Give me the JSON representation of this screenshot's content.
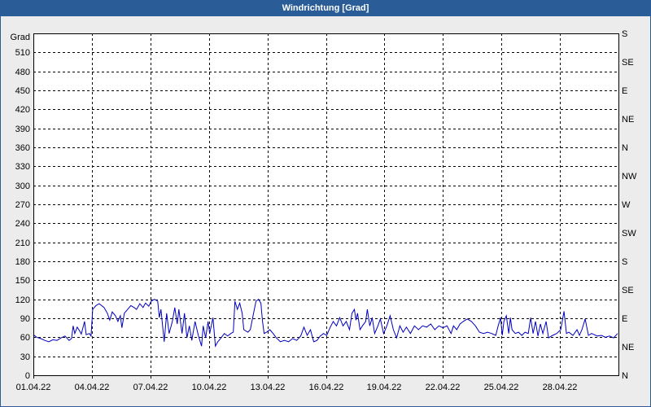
{
  "chart_data": {
    "type": "line",
    "title": "Windrichtung [Grad]",
    "xlabel": "",
    "ylabel": "Grad",
    "xlim": [
      "01.04.22 00:00",
      "01.05.22 00:00"
    ],
    "ylim": [
      0,
      540
    ],
    "grid": true,
    "x_ticks": [
      "01.04.22",
      "04.04.22",
      "07.04.22",
      "10.04.22",
      "13.04.22",
      "16.04.22",
      "19.04.22",
      "22.04.22",
      "25.04.22",
      "28.04.22"
    ],
    "y_ticks": [
      0,
      30,
      60,
      90,
      120,
      150,
      180,
      210,
      240,
      270,
      300,
      330,
      360,
      390,
      420,
      450,
      480,
      510
    ],
    "y2_ticks": [
      {
        "value": 0,
        "label": "N"
      },
      {
        "value": 45,
        "label": "NE"
      },
      {
        "value": 90,
        "label": "E"
      },
      {
        "value": 135,
        "label": "SE"
      },
      {
        "value": 180,
        "label": "S"
      },
      {
        "value": 225,
        "label": "SW"
      },
      {
        "value": 270,
        "label": "W"
      },
      {
        "value": 315,
        "label": "NW"
      },
      {
        "value": 360,
        "label": "N"
      },
      {
        "value": 405,
        "label": "NE"
      },
      {
        "value": 450,
        "label": "E"
      },
      {
        "value": 495,
        "label": "SE"
      },
      {
        "value": 540,
        "label": "S"
      }
    ],
    "colors": {
      "series": "#0000c0",
      "title_bar": "#2a5d98",
      "grid": "#000000",
      "plot_background": "#ffffff",
      "panel_background": "#ececec"
    },
    "series": [
      {
        "x": [
          "01.04.22 00:00",
          "01.04.22 04:00",
          "01.04.22 09:00",
          "01.04.22 14:00",
          "01.04.22 19:00",
          "02.04.22 00:00",
          "02.04.22 05:00",
          "02.04.22 10:00",
          "02.04.22 15:00",
          "02.04.22 20:00",
          "02.04.22 23:00",
          "03.04.22 01:00",
          "03.04.22 03:00",
          "03.04.22 06:00",
          "03.04.22 09:00",
          "03.04.22 11:00",
          "03.04.22 15:00",
          "03.04.22 17:00",
          "03.04.22 21:00",
          "03.04.22 23:00",
          "04.04.22 01:00",
          "04.04.22 05:00",
          "04.04.22 09:00",
          "04.04.22 15:00",
          "04.04.22 19:00",
          "04.04.22 22:00",
          "05.04.22 01:00",
          "05.04.22 05:00",
          "05.04.22 08:00",
          "05.04.22 11:00",
          "05.04.22 13:00",
          "05.04.22 16:00",
          "05.04.22 20:00",
          "06.04.22 00:00",
          "06.04.22 04:00",
          "06.04.22 07:00",
          "06.04.22 11:00",
          "06.04.22 15:00",
          "06.04.22 18:00",
          "06.04.22 22:00",
          "07.04.22 01:00",
          "07.04.22 05:00",
          "07.04.22 09:00",
          "07.04.22 11:00",
          "07.04.22 13:00",
          "07.04.22 15:00",
          "07.04.22 17:00",
          "07.04.22 20:00",
          "07.04.22 23:00",
          "08.04.22 03:00",
          "08.04.22 06:00",
          "08.04.22 09:00",
          "08.04.22 11:00",
          "08.04.22 15:00",
          "08.04.22 18:00",
          "08.04.22 21:00",
          "09.04.22 00:00",
          "09.04.22 03:00",
          "09.04.22 07:00",
          "09.04.22 11:00",
          "09.04.22 15:00",
          "09.04.22 17:00",
          "09.04.22 20:00",
          "09.04.22 23:00",
          "10.04.22 01:00",
          "10.04.22 05:00",
          "10.04.22 08:00",
          "10.04.22 11:00",
          "10.04.22 15:00",
          "10.04.22 19:00",
          "10.04.22 23:00",
          "11.04.22 03:00",
          "11.04.22 06:00",
          "11.04.22 08:00",
          "11.04.22 11:00",
          "11.04.22 14:00",
          "11.04.22 17:00",
          "11.04.22 19:00",
          "12.04.22 00:00",
          "12.04.22 03:00",
          "12.04.22 07:00",
          "12.04.22 10:00",
          "12.04.22 13:00",
          "12.04.22 16:00",
          "12.04.22 18:00",
          "12.04.22 20:00",
          "12.04.22 23:00",
          "13.04.22 03:00",
          "13.04.22 07:00",
          "13.04.22 11:00",
          "13.04.22 16:00",
          "13.04.22 21:00",
          "14.04.22 02:00",
          "14.04.22 07:00",
          "14.04.22 12:00",
          "14.04.22 17:00",
          "14.04.22 21:00",
          "15.04.22 01:00",
          "15.04.22 05:00",
          "15.04.22 09:00",
          "15.04.22 13:00",
          "15.04.22 17:00",
          "15.04.22 21:00",
          "16.04.22 01:00",
          "16.04.22 05:00",
          "16.04.22 09:00",
          "16.04.22 13:00",
          "16.04.22 17:00",
          "16.04.22 21:00",
          "17.04.22 01:00",
          "17.04.22 05:00",
          "17.04.22 08:00",
          "17.04.22 11:00",
          "17.04.22 13:00",
          "17.04.22 15:00",
          "17.04.22 18:00",
          "17.04.22 21:00",
          "18.04.22 01:00",
          "18.04.22 03:00",
          "18.04.22 06:00",
          "18.04.22 09:00",
          "18.04.22 12:00",
          "18.04.22 16:00",
          "18.04.22 19:00",
          "18.04.22 23:00",
          "19.04.22 03:00",
          "19.04.22 07:00",
          "19.04.22 11:00",
          "19.04.22 15:00",
          "19.04.22 19:00",
          "19.04.22 23:00",
          "20.04.22 03:00",
          "20.04.22 08:00",
          "20.04.22 13:00",
          "20.04.22 18:00",
          "20.04.22 23:00",
          "21.04.22 04:00",
          "21.04.22 09:00",
          "21.04.22 14:00",
          "21.04.22 19:00",
          "22.04.22 00:00",
          "22.04.22 05:00",
          "22.04.22 10:00",
          "22.04.22 13:00",
          "22.04.22 17:00",
          "22.04.22 21:00",
          "23.04.22 01:00",
          "23.04.22 06:00",
          "23.04.22 11:00",
          "23.04.22 16:00",
          "23.04.22 21:00",
          "24.04.22 02:00",
          "24.04.22 07:00",
          "24.04.22 12:00",
          "24.04.22 17:00",
          "24.04.22 20:00",
          "24.04.22 23:00",
          "25.04.22 01:00",
          "25.04.22 03:00",
          "25.04.22 06:00",
          "25.04.22 09:00",
          "25.04.22 11:00",
          "25.04.22 13:00",
          "25.04.22 17:00",
          "25.04.22 21:00",
          "26.04.22 01:00",
          "26.04.22 05:00",
          "26.04.22 09:00",
          "26.04.22 12:00",
          "26.04.22 15:00",
          "26.04.22 18:00",
          "26.04.22 21:00",
          "27.04.22 00:00",
          "27.04.22 03:00",
          "27.04.22 07:00",
          "27.04.22 10:00",
          "27.04.22 15:00",
          "27.04.22 20:00",
          "28.04.22 01:00",
          "28.04.22 05:00",
          "28.04.22 08:00",
          "28.04.22 11:00",
          "28.04.22 16:00",
          "28.04.22 21:00",
          "29.04.22 00:00",
          "29.04.22 03:00",
          "29.04.22 07:00",
          "29.04.22 11:00",
          "29.04.22 15:00",
          "29.04.22 22:00",
          "30.04.22 03:00",
          "30.04.22 08:00",
          "30.04.22 13:00",
          "30.04.22 18:00",
          "30.04.22 23:00"
        ],
        "y": [
          64,
          60,
          58,
          55,
          53,
          56,
          55,
          59,
          62,
          55,
          58,
          78,
          66,
          76,
          70,
          65,
          85,
          64,
          66,
          62,
          104,
          110,
          113,
          107,
          98,
          87,
          100,
          94,
          85,
          94,
          75,
          98,
          104,
          110,
          107,
          104,
          113,
          107,
          114,
          109,
          117,
          120,
          117,
          91,
          104,
          78,
          53,
          98,
          66,
          85,
          107,
          81,
          104,
          66,
          98,
          59,
          78,
          55,
          85,
          63,
          46,
          78,
          59,
          85,
          66,
          91,
          46,
          53,
          59,
          66,
          62,
          66,
          68,
          117,
          104,
          114,
          98,
          72,
          68,
          72,
          98,
          117,
          120,
          114,
          85,
          66,
          68,
          72,
          66,
          59,
          53,
          55,
          53,
          58,
          55,
          62,
          76,
          63,
          72,
          53,
          55,
          62,
          66,
          63,
          75,
          85,
          78,
          91,
          78,
          85,
          72,
          98,
          104,
          87,
          98,
          72,
          78,
          85,
          104,
          78,
          91,
          66,
          78,
          89,
          66,
          78,
          94,
          72,
          59,
          78,
          68,
          76,
          66,
          78,
          72,
          78,
          76,
          81,
          72,
          78,
          75,
          78,
          66,
          78,
          72,
          81,
          85,
          89,
          85,
          78,
          68,
          66,
          68,
          66,
          63,
          78,
          91,
          63,
          85,
          94,
          66,
          91,
          72,
          66,
          68,
          63,
          68,
          66,
          91,
          66,
          85,
          62,
          81,
          66,
          85,
          59,
          63,
          66,
          72,
          101,
          66,
          68,
          63,
          72,
          63,
          72,
          89,
          63,
          66,
          62,
          63,
          60,
          62,
          59,
          66
        ]
      }
    ]
  }
}
